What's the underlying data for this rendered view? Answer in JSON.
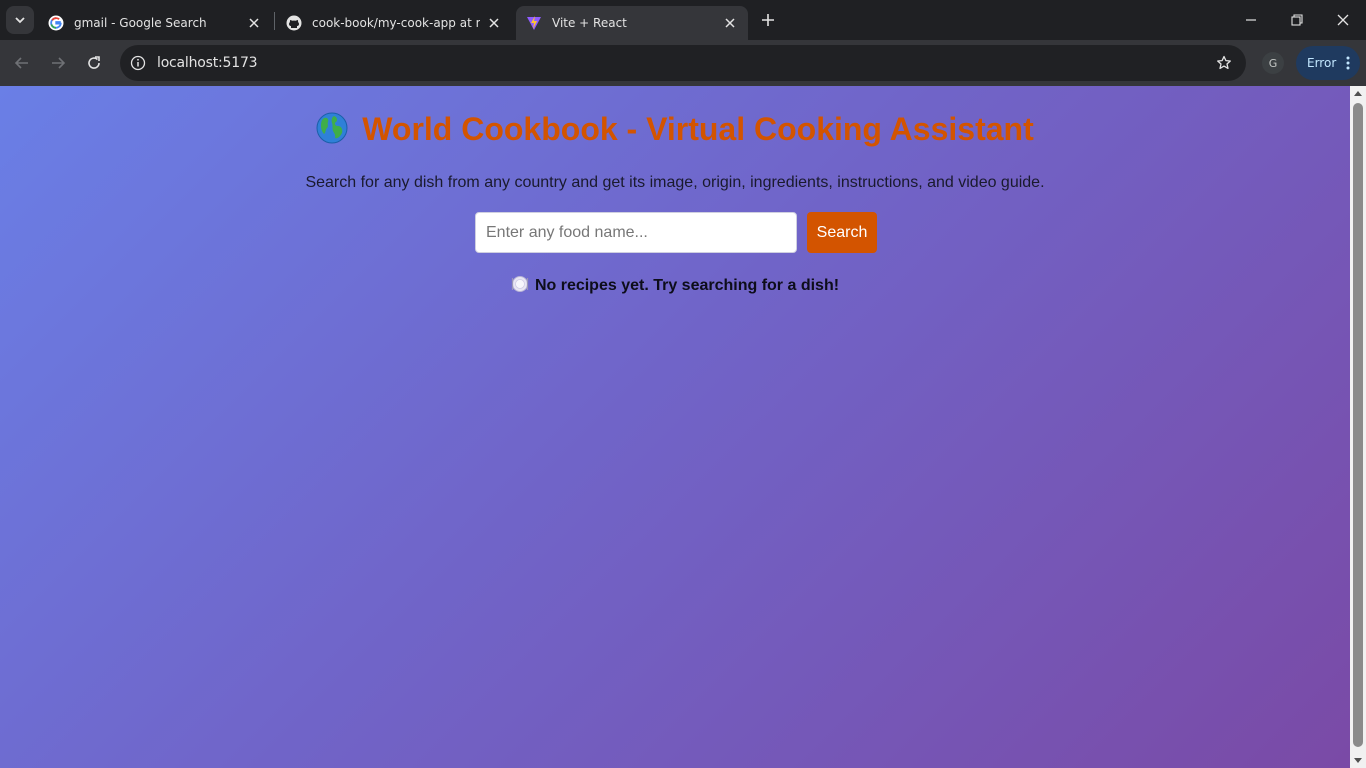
{
  "browser": {
    "tabs": [
      {
        "title": "gmail - Google Search",
        "favicon": "google-icon",
        "active": false
      },
      {
        "title": "cook-book/my-cook-app at main",
        "favicon": "github-icon",
        "active": false
      },
      {
        "title": "Vite + React",
        "favicon": "vite-icon",
        "active": true
      }
    ],
    "address": "localhost:5173",
    "profile_initial": "G",
    "error_label": "Error"
  },
  "page": {
    "title": "World Cookbook - Virtual Cooking Assistant",
    "subtitle": "Search for any dish from any country and get its image, origin, ingredients, instructions, and video guide.",
    "search": {
      "placeholder": "Enter any food name...",
      "value": "",
      "button_label": "Search"
    },
    "empty_message": "No recipes yet. Try searching for a dish!"
  },
  "colors": {
    "accent": "#d35400",
    "gradient_start": "#6a7fe6",
    "gradient_end": "#7a4aa6"
  }
}
